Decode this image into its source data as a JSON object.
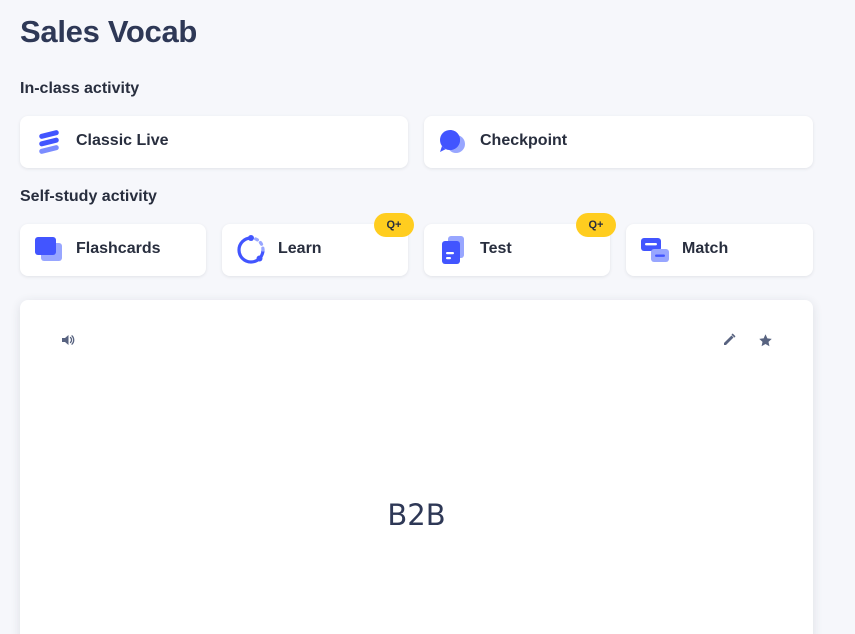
{
  "set": {
    "title": "Sales Vocab"
  },
  "in_class": {
    "heading": "In-class activity",
    "items": [
      {
        "label": "Classic Live",
        "icon": "classic-live-icon"
      },
      {
        "label": "Checkpoint",
        "icon": "checkpoint-icon"
      }
    ]
  },
  "self_study": {
    "heading": "Self-study activity",
    "items": [
      {
        "label": "Flashcards",
        "icon": "flashcards-icon",
        "badge": ""
      },
      {
        "label": "Learn",
        "icon": "learn-icon",
        "badge": "Q+"
      },
      {
        "label": "Test",
        "icon": "test-icon",
        "badge": "Q+"
      },
      {
        "label": "Match",
        "icon": "match-icon",
        "badge": ""
      }
    ]
  },
  "flashcard": {
    "term": "B2B",
    "audio_icon": "speaker-icon",
    "edit_icon": "pencil-icon",
    "star_icon": "star-icon"
  },
  "colors": {
    "background": "#f6f7fb",
    "accent": "#4255ff",
    "badge": "#ffcd1f",
    "text": "#282e3e"
  }
}
